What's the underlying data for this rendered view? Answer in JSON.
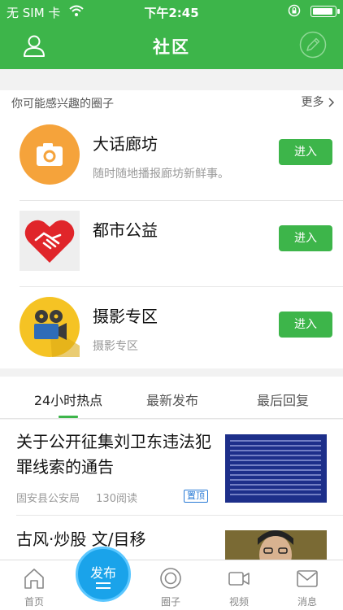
{
  "status_bar": {
    "carrier": "无 SIM 卡",
    "time": "下午2:45"
  },
  "header": {
    "title": "社区"
  },
  "recommend": {
    "label": "你可能感兴趣的圈子",
    "more": "更多",
    "join_label": "进入",
    "items": [
      {
        "name": "大话廊坊",
        "desc": "随时随地播报廊坊新鲜事。",
        "icon": "camera-icon"
      },
      {
        "name": "都市公益",
        "desc": "",
        "icon": "heart-handshake-icon"
      },
      {
        "name": "摄影专区",
        "desc": "摄影专区",
        "icon": "film-camera-icon"
      }
    ]
  },
  "tabs": {
    "items": [
      "24小时热点",
      "最新发布",
      "最后回复"
    ],
    "active": 0
  },
  "news": [
    {
      "title": "关于公开征集刘卫东违法犯罪线索的通告",
      "source": "固安县公安局",
      "reads": "130阅读",
      "pin": "置顶"
    },
    {
      "title": "古风·炒股  文/目移"
    }
  ],
  "tabbar": {
    "items": [
      "首页",
      "圈子",
      "视频",
      "消息"
    ],
    "publish": "发布"
  },
  "colors": {
    "brand_green": "#3db54a",
    "publish_blue": "#1aa3ea",
    "pin_blue": "#2a7bd6"
  }
}
